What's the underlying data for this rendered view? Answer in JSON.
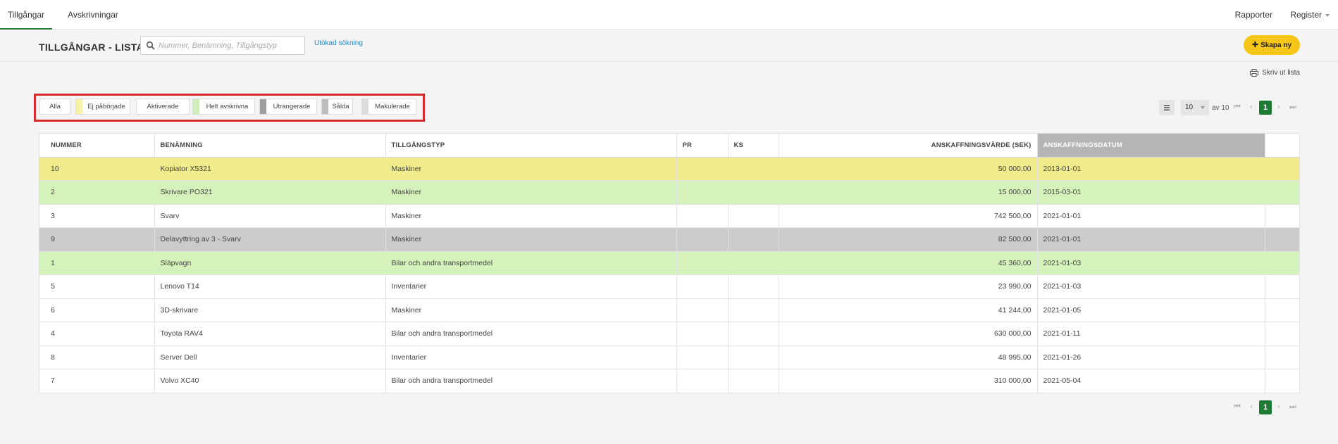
{
  "nav": {
    "tabs": [
      {
        "label": "Tillgångar"
      },
      {
        "label": "Avskrivningar"
      }
    ],
    "right": {
      "rapporter": "Rapporter",
      "register": "Register"
    }
  },
  "header": {
    "title": "TILLGÅNGAR - LISTA",
    "search_placeholder": "Nummer, Benämning, Tillgångstyp",
    "advanced_search": "Utökad sökning",
    "create_label": "Skapa ny",
    "print_label": "Skriv ut lista"
  },
  "filters": [
    {
      "label": "Alla",
      "color": ""
    },
    {
      "label": "Ej påbörjade",
      "color": "#f7f3a9"
    },
    {
      "label": "Aktiverade",
      "color": ""
    },
    {
      "label": "Helt avskrivna",
      "color": "#cfeebb"
    },
    {
      "label": "Utrangerade",
      "color": "#9e9e9e"
    },
    {
      "label": "Sålda",
      "color": "#bdbdbd"
    },
    {
      "label": "Makulerade",
      "color": "#dcdcdc"
    }
  ],
  "pagination": {
    "per_page": "10",
    "of_text": "av 10",
    "current_page": "1"
  },
  "table": {
    "columns": [
      "NUMMER",
      "BENÄMNING",
      "TILLGÅNGSTYP",
      "PR",
      "KS",
      "ANSKAFFNINGSVÄRDE (SEK)",
      "ANSKAFFNINGSDATUM",
      ""
    ],
    "rows": [
      {
        "status": "yellow",
        "cells": [
          "10",
          "Kopiator X5321",
          "Maskiner",
          "",
          "",
          "50 000,00",
          "2013-01-01",
          ""
        ]
      },
      {
        "status": "green",
        "cells": [
          "2",
          "Skrivare PO321",
          "Maskiner",
          "",
          "",
          "15 000,00",
          "2015-03-01",
          ""
        ]
      },
      {
        "status": "white",
        "cells": [
          "3",
          "Svarv",
          "Maskiner",
          "",
          "",
          "742 500,00",
          "2021-01-01",
          ""
        ]
      },
      {
        "status": "gray",
        "cells": [
          "9",
          "Delavyttring av 3 - Svarv",
          "Maskiner",
          "",
          "",
          "82 500,00",
          "2021-01-01",
          ""
        ]
      },
      {
        "status": "green",
        "cells": [
          "1",
          "Släpvagn",
          "Bilar och andra transportmedel",
          "",
          "",
          "45 360,00",
          "2021-01-03",
          ""
        ]
      },
      {
        "status": "white",
        "cells": [
          "5",
          "Lenovo T14",
          "Inventarier",
          "",
          "",
          "23 990,00",
          "2021-01-03",
          ""
        ]
      },
      {
        "status": "white",
        "cells": [
          "6",
          "3D-skrivare",
          "Maskiner",
          "",
          "",
          "41 244,00",
          "2021-01-05",
          ""
        ]
      },
      {
        "status": "white",
        "cells": [
          "4",
          "Toyota RAV4",
          "Bilar och andra transportmedel",
          "",
          "",
          "630 000,00",
          "2021-01-11",
          ""
        ]
      },
      {
        "status": "white",
        "cells": [
          "8",
          "Server Dell",
          "Inventarier",
          "",
          "",
          "48 995,00",
          "2021-01-26",
          ""
        ]
      },
      {
        "status": "white",
        "cells": [
          "7",
          "Volvo XC40",
          "Bilar och andra transportmedel",
          "",
          "",
          "310 000,00",
          "2021-05-04",
          ""
        ]
      }
    ]
  },
  "colors": {
    "accent_green": "#1e7b34",
    "create_yellow": "#f5c518",
    "link_blue": "#2a89c8",
    "highlight_red": "#d12b2b"
  }
}
